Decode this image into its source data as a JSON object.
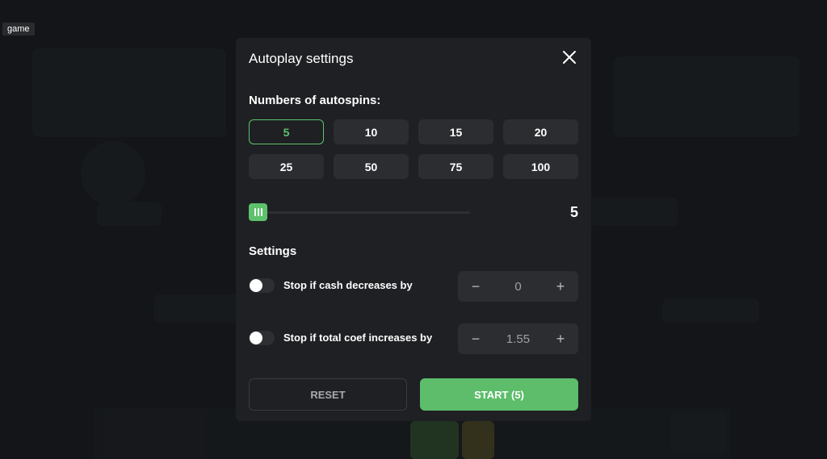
{
  "page": {
    "tag_label": "game"
  },
  "modal": {
    "title": "Autoplay settings",
    "close_icon": "close-icon",
    "autospins_label": "Numbers of autospins:",
    "options": [
      "5",
      "10",
      "15",
      "20",
      "25",
      "50",
      "75",
      "100"
    ],
    "selected_option": "5",
    "slider_value": "5",
    "settings_label": "Settings",
    "rules": [
      {
        "label": "Stop if cash decreases by",
        "value": "0",
        "enabled": false
      },
      {
        "label": "Stop if total coef increases by",
        "value": "1.55",
        "enabled": false
      }
    ],
    "stepper_minus": "−",
    "stepper_plus": "+",
    "reset_label": "RESET",
    "start_label": "START (5)"
  },
  "colors": {
    "accent": "#5dc26b",
    "modal_bg": "#1f2024",
    "button_bg": "#2c2d31"
  }
}
